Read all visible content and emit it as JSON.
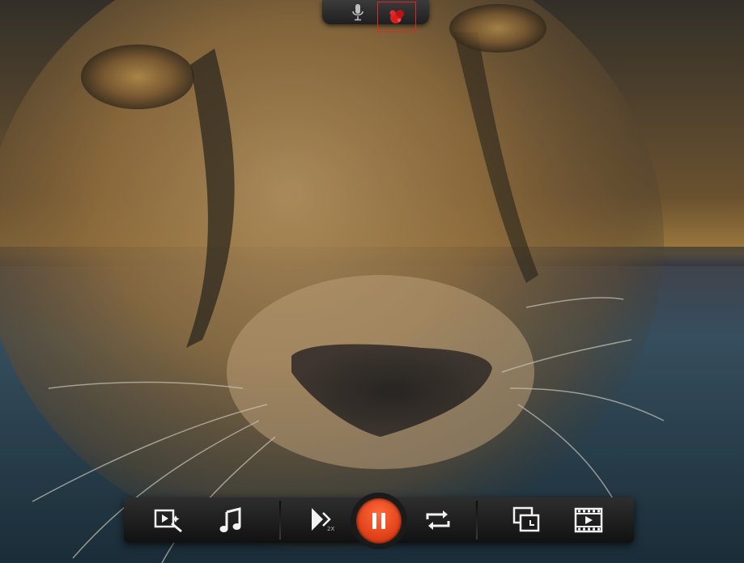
{
  "top_panel": {
    "mic_icon": "microphone-icon",
    "record_icon": "webcam-record-icon",
    "record_color": "#e12626"
  },
  "toolbar": {
    "speed_label": "2X",
    "buttons": [
      "video-effects-icon",
      "music-icon",
      "play-speed-icon",
      "pause-icon",
      "loop-icon",
      "picture-in-picture-icon",
      "film-strip-icon"
    ],
    "accent": "#e1431a"
  }
}
